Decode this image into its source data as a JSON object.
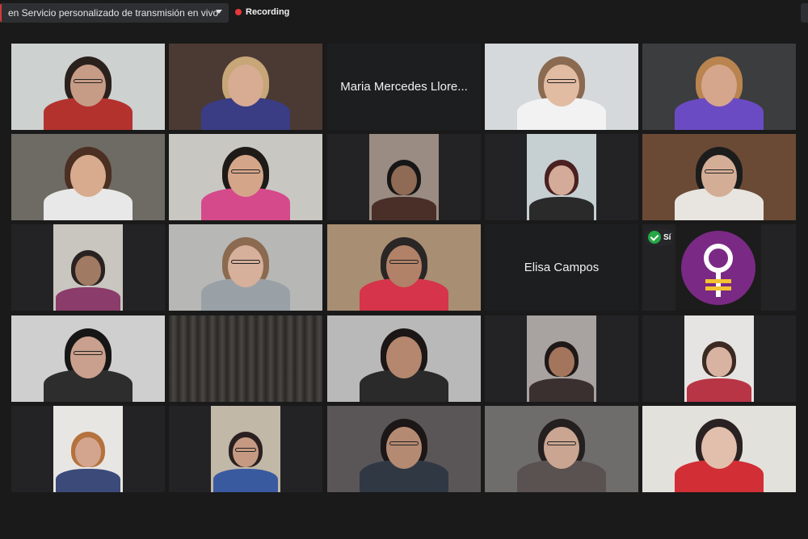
{
  "toolbar": {
    "stream_title": "en Servicio personalizado de transmisión en vivo",
    "recording_label": "Recording"
  },
  "tiles": [
    {
      "type": "video",
      "bg": "#cdd1d0",
      "skin": "#c79c86",
      "hair": "#2b211c",
      "shirt": "#b3322e",
      "glasses": true
    },
    {
      "type": "video",
      "bg": "#4b3a33",
      "skin": "#d8ab93",
      "hair": "#c7a678",
      "shirt": "#3a3d84",
      "active": true
    },
    {
      "type": "name",
      "name": "Maria Mercedes Llore..."
    },
    {
      "type": "video",
      "bg": "#d6d9dc",
      "skin": "#e2bba3",
      "hair": "#8a6a50",
      "shirt": "#f2f2f2",
      "glasses": true
    },
    {
      "type": "video",
      "bg": "#3b3d3f",
      "skin": "#d5a68c",
      "hair": "#b9844f",
      "shirt": "#6b4bc3"
    },
    {
      "type": "video",
      "bg": "#6e6a64",
      "skin": "#d8ab8e",
      "hair": "#4a2f22",
      "shirt": "#e8e8e8"
    },
    {
      "type": "video",
      "bg": "#c9c7c2",
      "skin": "#d5a58a",
      "hair": "#1e1a18",
      "shirt": "#d54a8a",
      "glasses": true
    },
    {
      "type": "video",
      "bg": "#9a8c82",
      "skin": "#8f6a55",
      "hair": "#161616",
      "shirt": "#4a2f28",
      "pillar": true
    },
    {
      "type": "video",
      "bg": "#c6cfd2",
      "skin": "#d3ab98",
      "hair": "#4a2020",
      "shirt": "#2a2a2a",
      "pillar": true
    },
    {
      "type": "video",
      "bg": "#6a4a35",
      "skin": "#d4ad96",
      "hair": "#1c1c1c",
      "shirt": "#e8e4e0",
      "glasses": true
    },
    {
      "type": "video",
      "bg": "#c9c6c0",
      "skin": "#a07a62",
      "hair": "#2a2222",
      "shirt": "#8b3c6a",
      "pillar": true
    },
    {
      "type": "video",
      "bg": "#b7b8b6",
      "skin": "#d6b09b",
      "hair": "#8b6a50",
      "shirt": "#9aa1a6",
      "glasses": true
    },
    {
      "type": "video",
      "bg": "#a88e72",
      "skin": "#b18268",
      "hair": "#2a2626",
      "shirt": "#d5344a",
      "glasses": true
    },
    {
      "type": "name",
      "name": "Elisa Campos"
    },
    {
      "type": "logo",
      "badge": "Sí",
      "logo_bg": "#7a2a84"
    },
    {
      "type": "video",
      "bg": "#cfcfcf",
      "skin": "#c9a08d",
      "hair": "#161616",
      "shirt": "#2d2d2d",
      "glasses": true
    },
    {
      "type": "curtain",
      "bg": "#3c3a37"
    },
    {
      "type": "video",
      "bg": "#b9b9ba",
      "skin": "#b4876e",
      "hair": "#1c1616",
      "shirt": "#2a2a2a"
    },
    {
      "type": "video",
      "bg": "#a8a2a0",
      "skin": "#a3755c",
      "hair": "#1e1818",
      "shirt": "#3a3030",
      "pillar": true
    },
    {
      "type": "video",
      "bg": "#e6e4e2",
      "skin": "#d9b3a2",
      "hair": "#3a2a22",
      "shirt": "#b83545",
      "pillar": true
    },
    {
      "type": "video",
      "bg": "#e8e6e3",
      "skin": "#d4a58e",
      "hair": "#b5723d",
      "shirt": "#3c4a7a",
      "pillar": true
    },
    {
      "type": "video",
      "bg": "#c2b8a8",
      "skin": "#c69a82",
      "hair": "#2a2020",
      "shirt": "#3a5aa0",
      "glasses": true,
      "pillar": true
    },
    {
      "type": "video",
      "bg": "#5a5658",
      "skin": "#b58a72",
      "hair": "#1c1616",
      "shirt": "#303844",
      "glasses": true
    },
    {
      "type": "video",
      "bg": "#6e6d6c",
      "skin": "#caa592",
      "hair": "#242020",
      "shirt": "#5a5250",
      "glasses": true
    },
    {
      "type": "video",
      "bg": "#e3e1dc",
      "skin": "#e1bfac",
      "hair": "#2a2222",
      "shirt": "#d22e35"
    }
  ]
}
